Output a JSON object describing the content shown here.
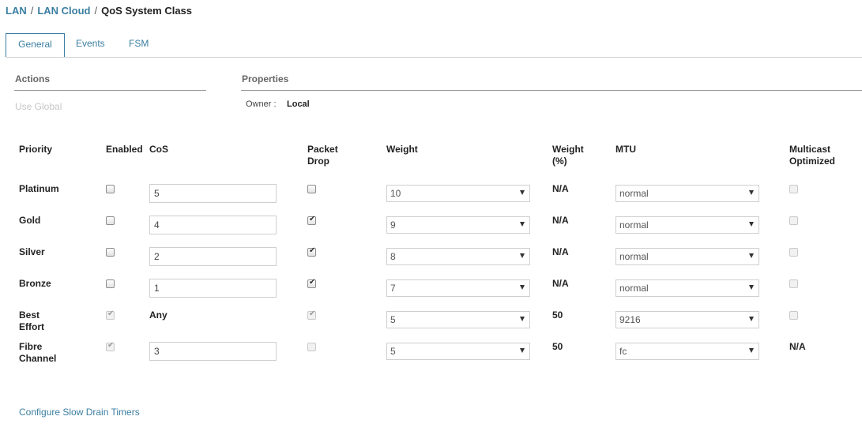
{
  "breadcrumb": {
    "items": [
      "LAN",
      "LAN Cloud"
    ],
    "current": "QoS System Class",
    "sep": "/"
  },
  "tabs": [
    "General",
    "Events",
    "FSM"
  ],
  "actions": {
    "title": "Actions",
    "use_global": "Use Global"
  },
  "properties": {
    "title": "Properties",
    "owner_label": "Owner :",
    "owner_value": "Local"
  },
  "table": {
    "headers": {
      "priority": "Priority",
      "enabled": "Enabled",
      "cos": "CoS",
      "packet_drop": [
        "Packet",
        "Drop"
      ],
      "weight": "Weight",
      "weight_pct": [
        "Weight",
        "(%)"
      ],
      "mtu": "MTU",
      "multicast": [
        "Multicast",
        "Optimized"
      ]
    },
    "rows": [
      {
        "priority": [
          "Platinum"
        ],
        "enabled": false,
        "enabled_disabled": false,
        "cos": "5",
        "cos_static": false,
        "packet_drop": false,
        "packet_drop_disabled": false,
        "weight": "10",
        "weight_pct": "N/A",
        "mtu": "normal",
        "multicast": "checkbox"
      },
      {
        "priority": [
          "Gold"
        ],
        "enabled": false,
        "enabled_disabled": false,
        "cos": "4",
        "cos_static": false,
        "packet_drop": true,
        "packet_drop_disabled": false,
        "weight": "9",
        "weight_pct": "N/A",
        "mtu": "normal",
        "multicast": "checkbox"
      },
      {
        "priority": [
          "Silver"
        ],
        "enabled": false,
        "enabled_disabled": false,
        "cos": "2",
        "cos_static": false,
        "packet_drop": true,
        "packet_drop_disabled": false,
        "weight": "8",
        "weight_pct": "N/A",
        "mtu": "normal",
        "multicast": "checkbox"
      },
      {
        "priority": [
          "Bronze"
        ],
        "enabled": false,
        "enabled_disabled": false,
        "cos": "1",
        "cos_static": false,
        "packet_drop": true,
        "packet_drop_disabled": false,
        "weight": "7",
        "weight_pct": "N/A",
        "mtu": "normal",
        "multicast": "checkbox"
      },
      {
        "priority": [
          "Best",
          "Effort"
        ],
        "enabled": true,
        "enabled_disabled": true,
        "cos": "Any",
        "cos_static": true,
        "packet_drop": true,
        "packet_drop_disabled": true,
        "weight": "5",
        "weight_pct": "50",
        "mtu": "9216",
        "multicast": "checkbox"
      },
      {
        "priority": [
          "Fibre",
          "Channel"
        ],
        "enabled": true,
        "enabled_disabled": true,
        "cos": "3",
        "cos_static": false,
        "packet_drop": false,
        "packet_drop_disabled": true,
        "weight": "5",
        "weight_pct": "50",
        "mtu": "fc",
        "multicast": "N/A"
      }
    ]
  },
  "footer": {
    "link": "Configure Slow Drain Timers"
  }
}
